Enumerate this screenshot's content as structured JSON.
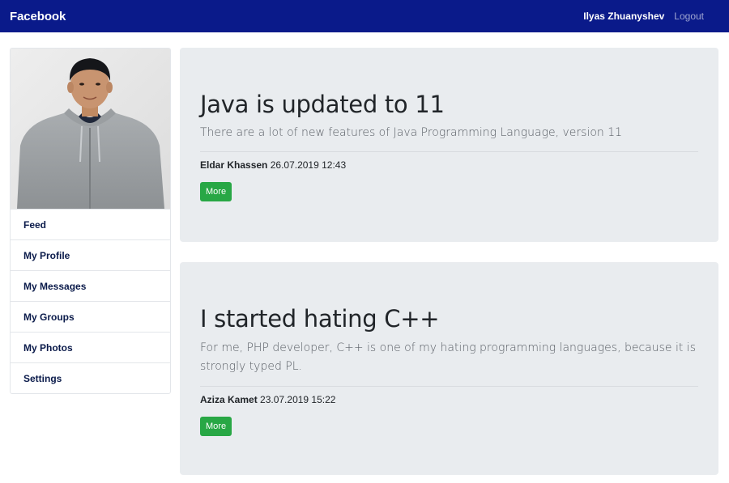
{
  "colors": {
    "navbar": "#0a1a8a",
    "card_bg": "#e9ecef",
    "button_green": "#28a745"
  },
  "navbar": {
    "brand": "Facebook",
    "user_name": "Ilyas Zhuanyshev",
    "logout": "Logout"
  },
  "sidebar": {
    "items": [
      {
        "label": "Feed"
      },
      {
        "label": "My Profile"
      },
      {
        "label": "My Messages"
      },
      {
        "label": "My Groups"
      },
      {
        "label": "My Photos"
      },
      {
        "label": "Settings"
      }
    ]
  },
  "posts": [
    {
      "title": "Java is updated to 11",
      "lead": "There are a lot of new features of Java Programming Language, version 11",
      "author": "Eldar Khassen",
      "date": "26.07.2019 12:43",
      "button": "More"
    },
    {
      "title": "I started hating C++",
      "lead": "For me, PHP developer, C++ is one of my hating programming languages, because it is strongly typed PL.",
      "author": "Aziza Kamet",
      "date": "23.07.2019 15:22",
      "button": "More"
    }
  ]
}
